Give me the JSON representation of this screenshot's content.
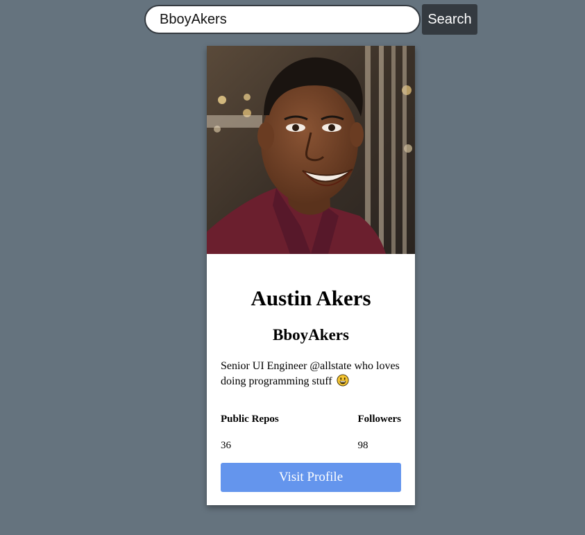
{
  "search": {
    "value": "BboyAkers",
    "button_label": "Search"
  },
  "profile": {
    "avatar_icon": "person-photo",
    "full_name": "Austin Akers",
    "username": "BboyAkers",
    "bio": "Senior UI Engineer @allstate who loves doing programming stuff",
    "bio_emoji_icon": "grinning-face-emoji",
    "stats": {
      "repos_label": "Public Repos",
      "repos_value": "36",
      "followers_label": "Followers",
      "followers_value": "98"
    },
    "visit_label": "Visit Profile"
  },
  "colors": {
    "page_background": "#65737e",
    "search_button": "#343a40",
    "visit_button": "#6495ed"
  }
}
